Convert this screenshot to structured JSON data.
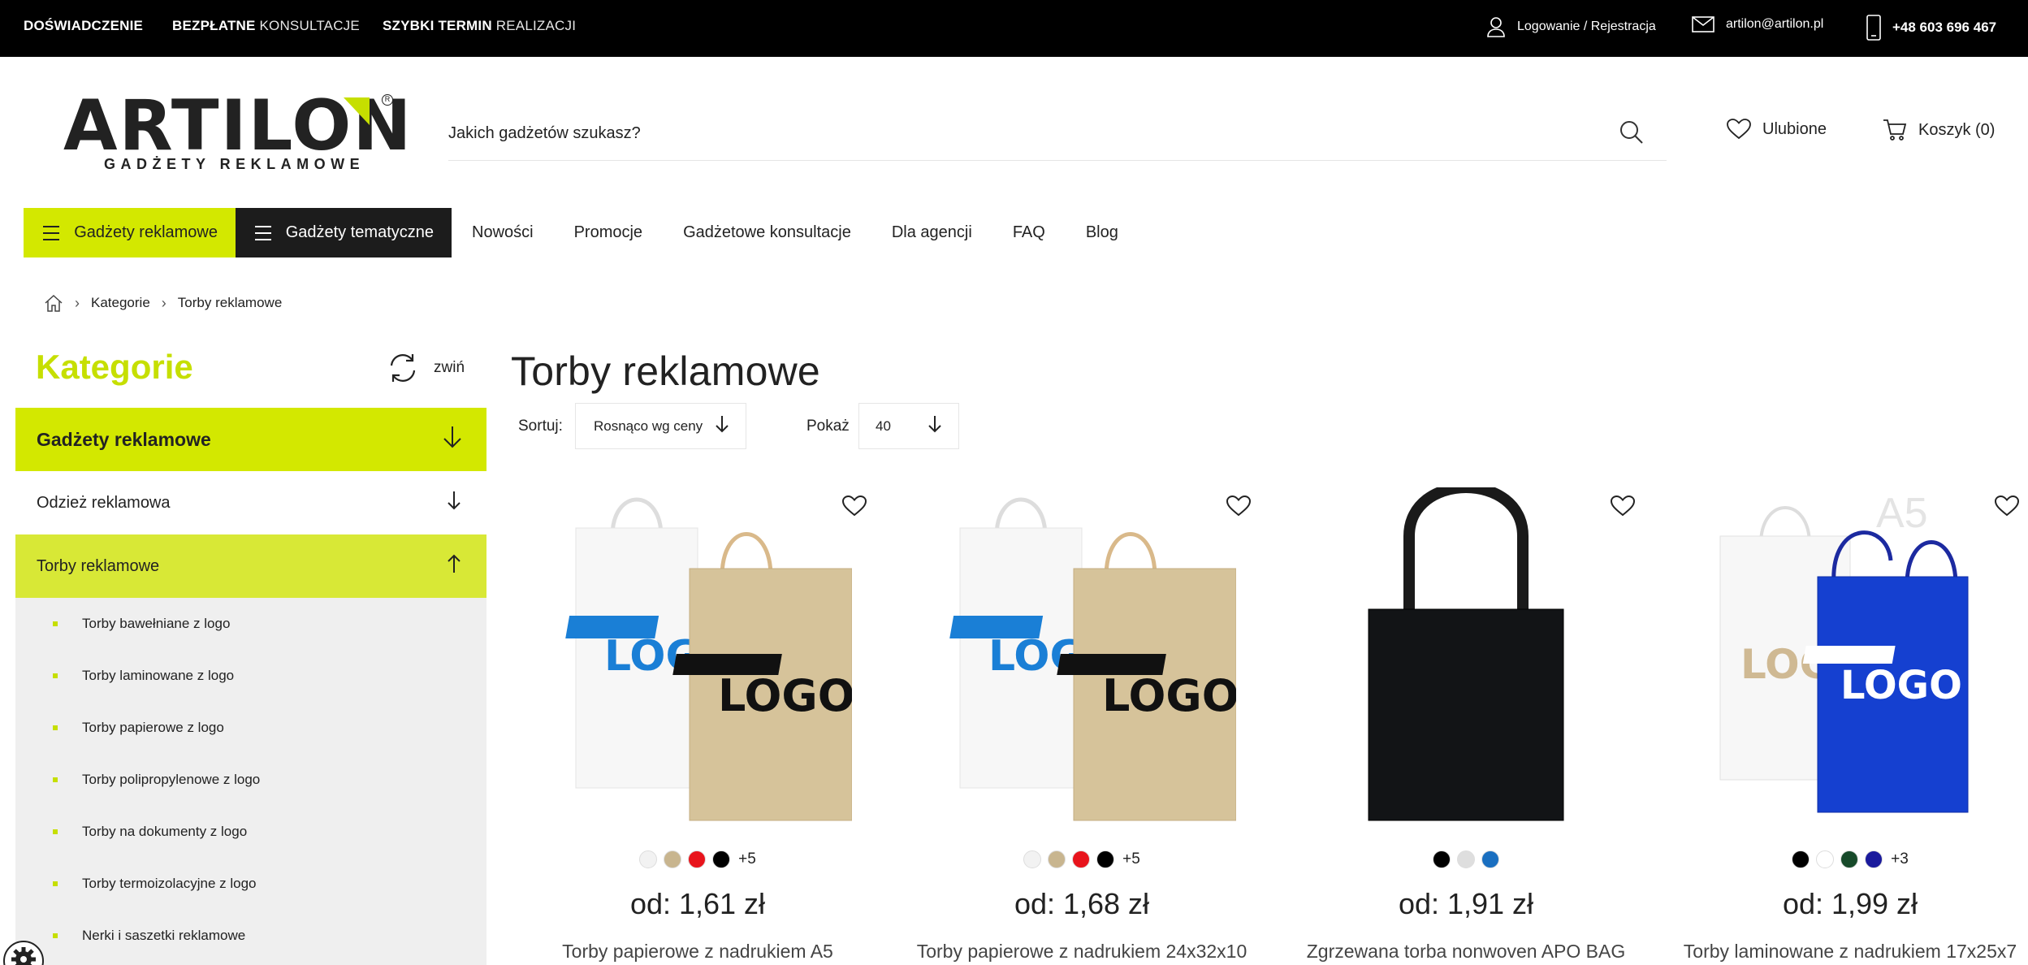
{
  "topbar": {
    "item1_bold": "DOŚWIADCZENIE",
    "item2_bold": "BEZPŁATNE",
    "item2_light": "KONSULTACJE",
    "item3_bold": "SZYBKI TERMIN",
    "item3_light": "REALIZACJI",
    "login": "Logowanie / Rejestracja",
    "email": "artilon@artilon.pl",
    "phone": "+48 603 696 467"
  },
  "logo": {
    "main": "ARTILON",
    "sub": "GADŻETY REKLAMOWE",
    "reg": "R"
  },
  "search": {
    "placeholder": "Jakich gadżetów szukasz?"
  },
  "header": {
    "favorites": "Ulubione",
    "cart": "Koszyk (0)"
  },
  "nav": {
    "menu1": "Gadżety reklamowe",
    "menu2": "Gadżety tematyczne",
    "links": [
      "Nowości",
      "Promocje",
      "Gadżetowe konsultacje",
      "Dla agencji",
      "FAQ",
      "Blog"
    ]
  },
  "breadcrumb": {
    "level1": "Kategorie",
    "level2": "Torby reklamowe"
  },
  "sidebar": {
    "title": "Kategorie",
    "collapse": "zwiń",
    "main_category": "Gadżety reklamowe",
    "sub_category": "Odzież reklamowa",
    "active_category": "Torby reklamowe",
    "items": [
      "Torby bawełniane z logo",
      "Torby laminowane z logo",
      "Torby papierowe z logo",
      "Torby polipropylenowe z logo",
      "Torby na dokumenty z logo",
      "Torby termoizolacyjne z logo",
      "Nerki i saszetki reklamowe"
    ]
  },
  "main": {
    "title": "Torby reklamowe",
    "sort_label": "Sortuj:",
    "sort_value": "Rosnąco wg ceny",
    "show_label": "Pokaż",
    "show_value": "40"
  },
  "products": [
    {
      "price": "od: 1,61 zł",
      "name": "Torby papierowe z nadrukiem A5",
      "colors": [
        "#f2f2f2",
        "#c8b58f",
        "#e8141c",
        "#000000"
      ],
      "more": "+5"
    },
    {
      "price": "od: 1,68 zł",
      "name": "Torby papierowe z nadrukiem 24x32x10",
      "colors": [
        "#f2f2f2",
        "#c8b58f",
        "#e8141c",
        "#000000"
      ],
      "more": "+5"
    },
    {
      "price": "od: 1,91 zł",
      "name": "Zgrzewana torba nonwoven APO BAG",
      "colors": [
        "#000000",
        "#dedede",
        "#1a6fc0"
      ],
      "more": ""
    },
    {
      "price": "od: 1,99 zł",
      "name": "Torby laminowane z nadrukiem 17x25x7",
      "colors": [
        "#000000",
        "#ffffff",
        "#174a2a",
        "#1a1a9c"
      ],
      "more": "+3",
      "badge": "A5"
    }
  ],
  "colors": {
    "accent": "#d3e800",
    "accent_text": "#c6df00",
    "dark": "#1c1c1c"
  }
}
